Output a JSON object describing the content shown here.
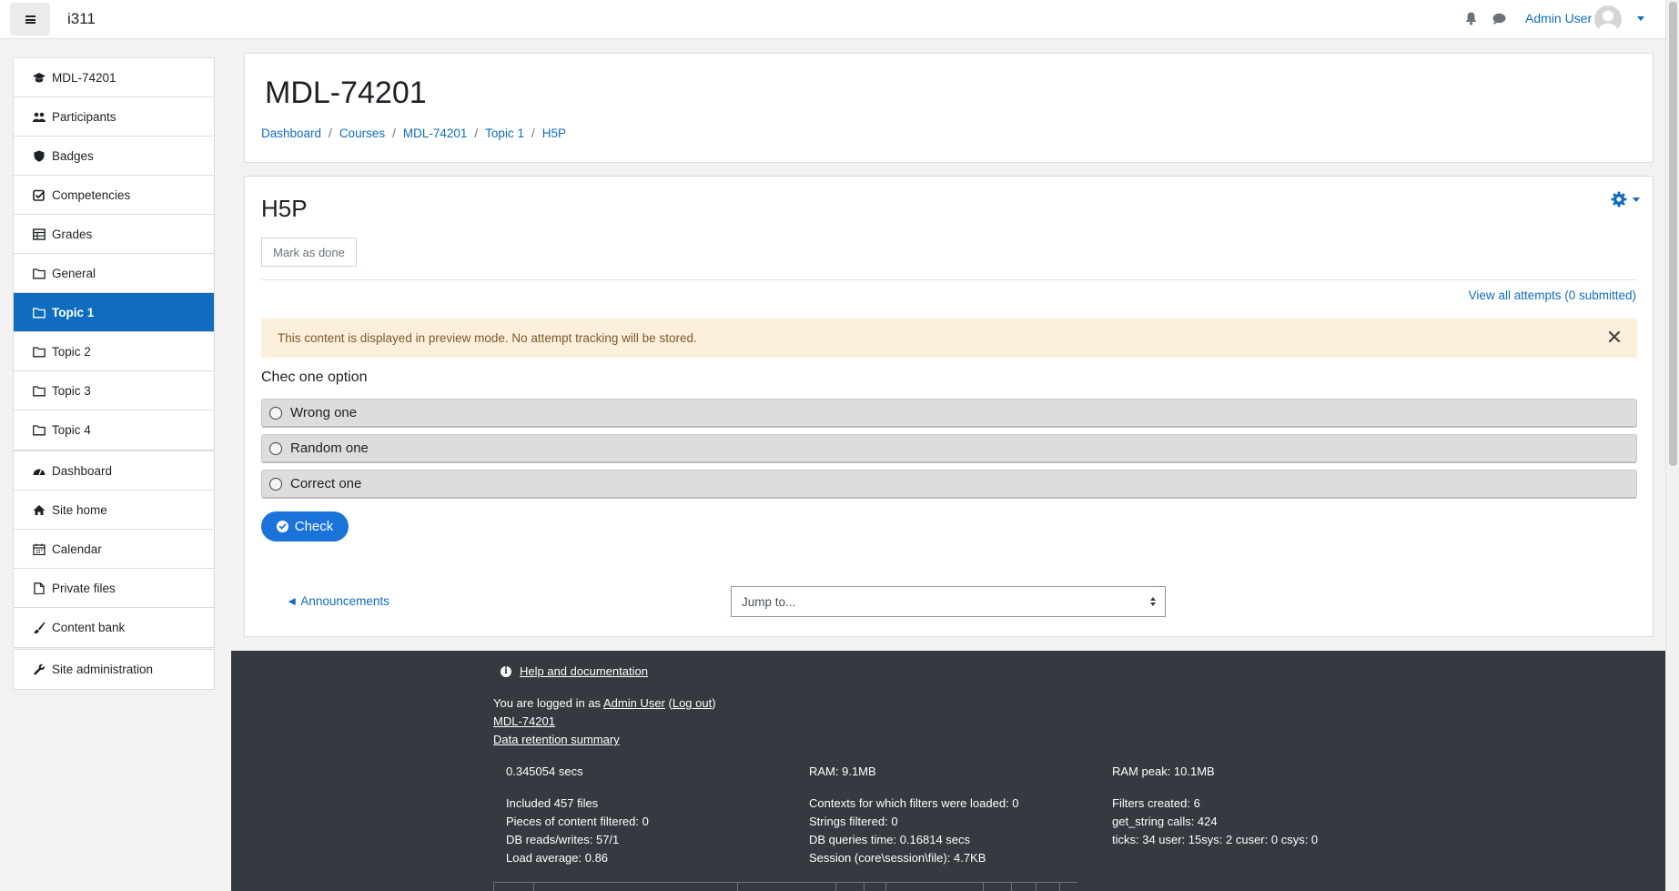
{
  "navbar": {
    "site_name": "i311",
    "user_name": "Admin User",
    "icons": [
      "bars-icon",
      "bell-icon",
      "comment-icon",
      "avatar",
      "caret-down-icon"
    ]
  },
  "sidebar": {
    "course_items": [
      {
        "label": "MDL-74201",
        "icon": "graduation-cap-icon"
      },
      {
        "label": "Participants",
        "icon": "users-icon"
      },
      {
        "label": "Badges",
        "icon": "shield-icon"
      },
      {
        "label": "Competencies",
        "icon": "check-square-icon"
      },
      {
        "label": "Grades",
        "icon": "table-icon"
      },
      {
        "label": "General",
        "icon": "folder-icon"
      },
      {
        "label": "Topic 1",
        "icon": "folder-icon",
        "active": true
      },
      {
        "label": "Topic 2",
        "icon": "folder-icon"
      },
      {
        "label": "Topic 3",
        "icon": "folder-icon"
      },
      {
        "label": "Topic 4",
        "icon": "folder-icon"
      }
    ],
    "site_items": [
      {
        "label": "Dashboard",
        "icon": "tachometer-icon"
      },
      {
        "label": "Site home",
        "icon": "home-icon"
      },
      {
        "label": "Calendar",
        "icon": "calendar-icon"
      },
      {
        "label": "Private files",
        "icon": "file-icon"
      },
      {
        "label": "Content bank",
        "icon": "paint-brush-icon"
      }
    ],
    "admin_items": [
      {
        "label": "Site administration",
        "icon": "wrench-icon"
      }
    ]
  },
  "header": {
    "title": "MDL-74201",
    "breadcrumb": [
      "Dashboard",
      "Courses",
      "MDL-74201",
      "Topic 1",
      "H5P"
    ]
  },
  "activity": {
    "title": "H5P",
    "mark_done": "Mark as done",
    "view_attempts": "View all attempts (0 submitted)",
    "alert": "This content is displayed in preview mode. No attempt tracking will be stored.",
    "question": "Chec one option",
    "options": [
      "Wrong one",
      "Random one",
      "Correct one"
    ],
    "check_label": "Check",
    "prev_link": "◄ Announcements",
    "jump_placeholder": "Jump to..."
  },
  "footer": {
    "help": "Help and documentation",
    "logged_prefix": "You are logged in as ",
    "logged_user": "Admin User",
    "logout": "Log out",
    "course_link": "MDL-74201",
    "retention": "Data retention summary",
    "perf_col1": [
      "0.345054 secs",
      "",
      "Included 457 files",
      "Pieces of content filtered: 0",
      "DB reads/writes: 57/1",
      "Load average: 0.86"
    ],
    "perf_col2": [
      "RAM: 9.1MB",
      "",
      "Contexts for which filters were loaded: 0",
      "Strings filtered: 0",
      "DB queries time: 0.16814 secs",
      "Session (core\\session\\file): 4.7KB"
    ],
    "perf_col3": [
      "RAM peak: 10.1MB",
      "",
      "Filters created: 6",
      "get_string calls: 424",
      "ticks: 34 user: 15sys: 2 cuser: 0 csys: 0"
    ]
  },
  "colors": {
    "accent": "#0f6cbf",
    "footer_bg": "#343a40",
    "alert_bg": "#fcefdc",
    "check_button": "#1a73d9"
  }
}
